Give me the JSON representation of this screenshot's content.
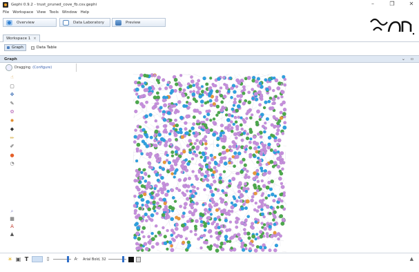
{
  "window": {
    "title": "Gephi 0.9.2 - trust_pruned_cove_fb.csv.gephi",
    "controls": [
      "–",
      "❐",
      "✕"
    ]
  },
  "menu": [
    "File",
    "Workspace",
    "View",
    "Tools",
    "Window",
    "Help"
  ],
  "perspectives": [
    {
      "label": "Overview",
      "active": true
    },
    {
      "label": "Data Laboratory",
      "active": false
    },
    {
      "label": "Preview",
      "active": false
    }
  ],
  "logo": {
    "icon": "gephi-logo"
  },
  "workspace_tab": {
    "label": "Workspace 1",
    "close": "×"
  },
  "graph_tabs": [
    {
      "label": "Graph",
      "active": true
    },
    {
      "label": "Data Table",
      "active": false
    }
  ],
  "graph_window": {
    "title": "Graph",
    "controls": "⌄ ▫"
  },
  "subtoolbar": {
    "label": "Dragging",
    "link": "(Configure)"
  },
  "tools": [
    {
      "icon": "hand-select-icon",
      "glyph": "☝",
      "color": "#d6a54a"
    },
    {
      "icon": "rectangle-select-icon",
      "glyph": "▢",
      "color": "#555555"
    },
    {
      "icon": "drag-icon",
      "glyph": "✥",
      "color": "#3d6fb5"
    },
    {
      "icon": "brush-icon",
      "glyph": "✎",
      "color": "#444444"
    },
    {
      "icon": "paint-icon",
      "glyph": "✿",
      "color": "#c07ac0"
    },
    {
      "icon": "heat-icon",
      "glyph": "✹",
      "color": "#e08a2a"
    },
    {
      "icon": "size-icon",
      "glyph": "◆",
      "color": "#333333"
    },
    {
      "icon": "pencil-icon",
      "glyph": "✏",
      "color": "#d0a020"
    },
    {
      "icon": "edge-pencil-icon",
      "glyph": "✐",
      "color": "#333333"
    },
    {
      "icon": "shortest-path-icon",
      "glyph": "●",
      "color": "#e5602a"
    },
    {
      "icon": "diffusion-icon",
      "glyph": "◔",
      "color": "#777777"
    }
  ],
  "tools_bottom": [
    {
      "icon": "screenshot-icon",
      "glyph": "⌕",
      "color": "#8a8ac8"
    },
    {
      "icon": "layout-icon",
      "glyph": "▦",
      "color": "#555555"
    },
    {
      "icon": "text-color-icon",
      "glyph": "A",
      "color": "#c0392b"
    },
    {
      "icon": "reset-icon",
      "glyph": "▲",
      "color": "#555555"
    }
  ],
  "graph": {
    "node_count": 1400,
    "colors": {
      "purple": "#c58fdc",
      "blue": "#2fa0e0",
      "green": "#4ca84c",
      "orange": "#e8973a",
      "edge": "#b9b9c8"
    },
    "mix": {
      "purple": 0.58,
      "blue": 0.22,
      "green": 0.18,
      "orange": 0.02
    }
  },
  "bottombar": {
    "font": "Arial Bold, 32",
    "edge_label_glyph": "T",
    "node_label_glyph": "A·",
    "right_icon": "▲"
  }
}
